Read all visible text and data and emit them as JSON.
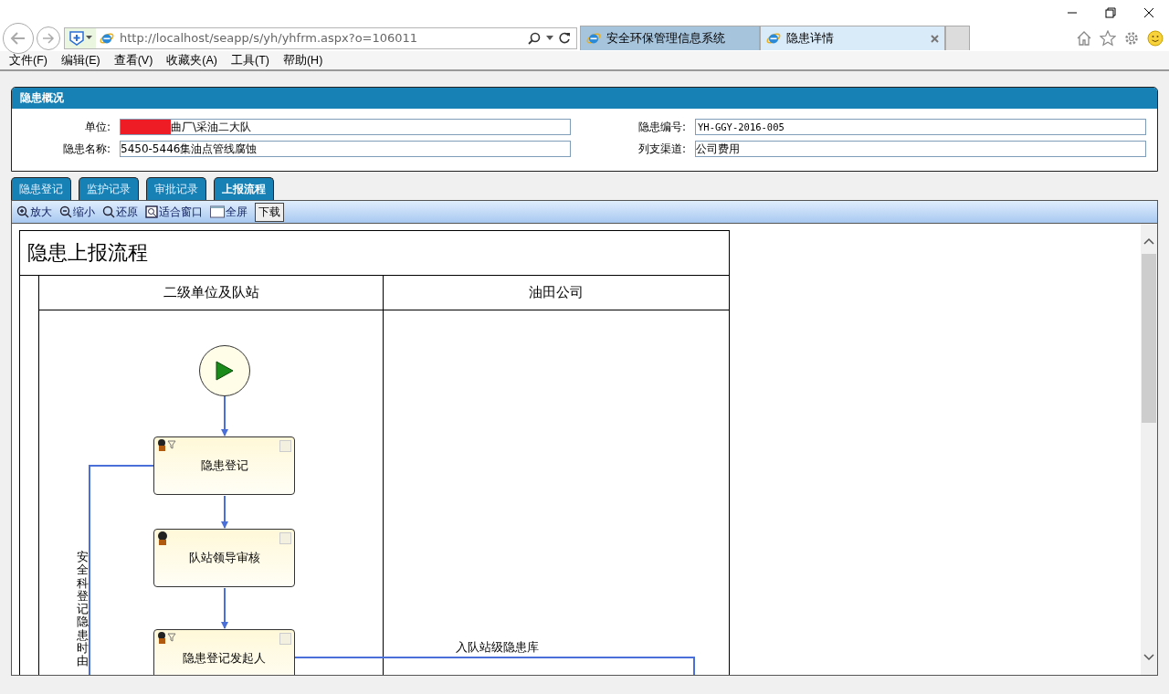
{
  "browser": {
    "url": "http://localhost/seapp/s/yh/yhfrm.aspx?o=106011",
    "tabs": [
      {
        "title": "安全环保管理信息系统",
        "selected": false
      },
      {
        "title": "隐患详情",
        "selected": true
      }
    ]
  },
  "menu": [
    "文件(F)",
    "编辑(E)",
    "查看(V)",
    "收藏夹(A)",
    "工具(T)",
    "帮助(H)"
  ],
  "panel": {
    "title": "隐患概况",
    "fields": [
      {
        "label": "单位:",
        "value": "曲厂\\采油二大队",
        "redacted": true,
        "mono": false
      },
      {
        "label": "隐患编号:",
        "value": "YH-GGY-2016-005",
        "redacted": false,
        "mono": true
      },
      {
        "label": "隐患名称:",
        "value": "5450-5446集油点管线腐蚀",
        "redacted": false,
        "mono": false
      },
      {
        "label": "列支渠道:",
        "value": "公司费用",
        "redacted": false,
        "mono": false
      }
    ]
  },
  "tabs": [
    {
      "label": "隐患登记",
      "selected": false
    },
    {
      "label": "监护记录",
      "selected": false
    },
    {
      "label": "审批记录",
      "selected": false
    },
    {
      "label": "上报流程",
      "selected": true
    }
  ],
  "toolbar": [
    {
      "kind": "zoom-in",
      "label": "放大"
    },
    {
      "kind": "zoom-out",
      "label": "缩小"
    },
    {
      "kind": "reset",
      "label": "还原"
    },
    {
      "kind": "fit",
      "label": "适合窗口"
    },
    {
      "kind": "fullscreen",
      "label": "全屏"
    },
    {
      "kind": "button",
      "label": "下载"
    }
  ],
  "diagram": {
    "title": "隐患上报流程",
    "lanes": [
      "二级单位及队站",
      "油田公司"
    ],
    "nodes": [
      {
        "kind": "task",
        "label": "隐患登记"
      },
      {
        "kind": "task",
        "label": "队站领导审核"
      },
      {
        "kind": "task",
        "label": "隐患登记发起人"
      }
    ],
    "edge_labels": [
      "安全科登记隐患时由",
      "入队站级隐患库"
    ]
  }
}
